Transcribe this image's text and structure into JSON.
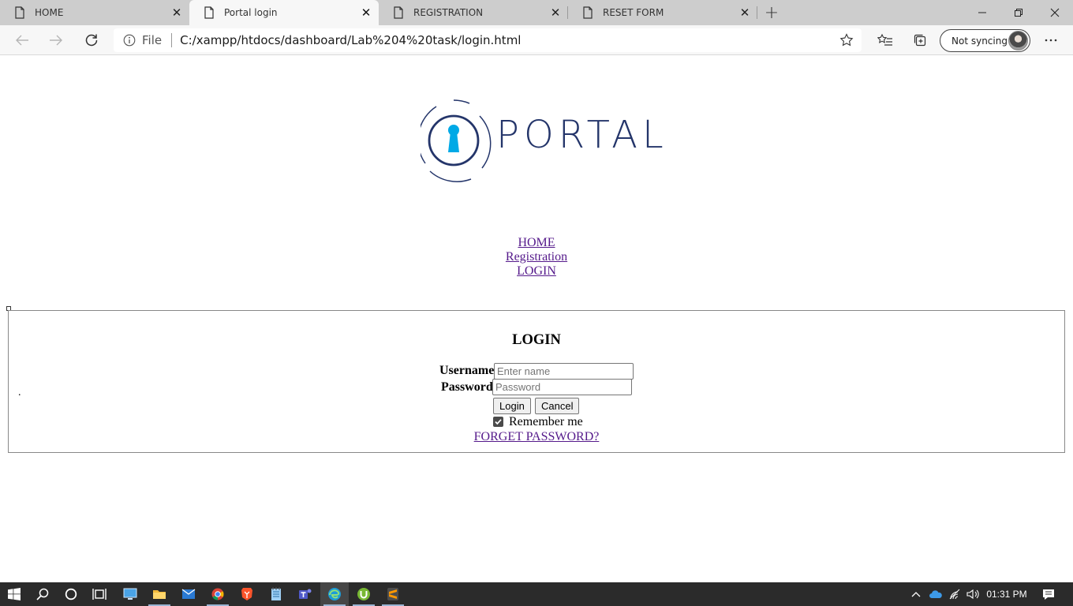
{
  "browser": {
    "tabs": [
      {
        "title": "HOME",
        "active": false
      },
      {
        "title": "Portal login",
        "active": true
      },
      {
        "title": "REGISTRATION",
        "active": false
      },
      {
        "title": "RESET FORM",
        "active": false
      }
    ],
    "address": {
      "scheme_label": "File",
      "url": "C:/xampp/htdocs/dashboard/Lab%204%20task/login.html"
    },
    "profile": {
      "sync_label": "Not syncing"
    }
  },
  "page": {
    "logo": {
      "text": "PORTAL",
      "color": "#24356a",
      "accent": "#00a9e6"
    },
    "nav": {
      "home": "HOME",
      "registration": "Registration",
      "login": "LOGIN"
    },
    "login_form": {
      "title": "LOGIN",
      "marker": ".",
      "username_label": "Username",
      "username_placeholder": "Enter name",
      "password_label": "Password",
      "password_placeholder": "Password",
      "login_button": "Login",
      "cancel_button": "Cancel",
      "remember_label": "Remember me",
      "remember_checked": true,
      "forgot_link": "FORGET PASSWORD?"
    }
  },
  "taskbar": {
    "apps": [
      "start-icon",
      "search-icon",
      "cortana-icon",
      "task-view-icon",
      "desktop-icon",
      "file-explorer-icon",
      "mail-icon",
      "chrome-icon",
      "brave-icon",
      "notepad-icon",
      "teams-icon",
      "edge-icon",
      "utorrent-icon",
      "sublime-icon"
    ],
    "clock": "01:31 PM"
  }
}
